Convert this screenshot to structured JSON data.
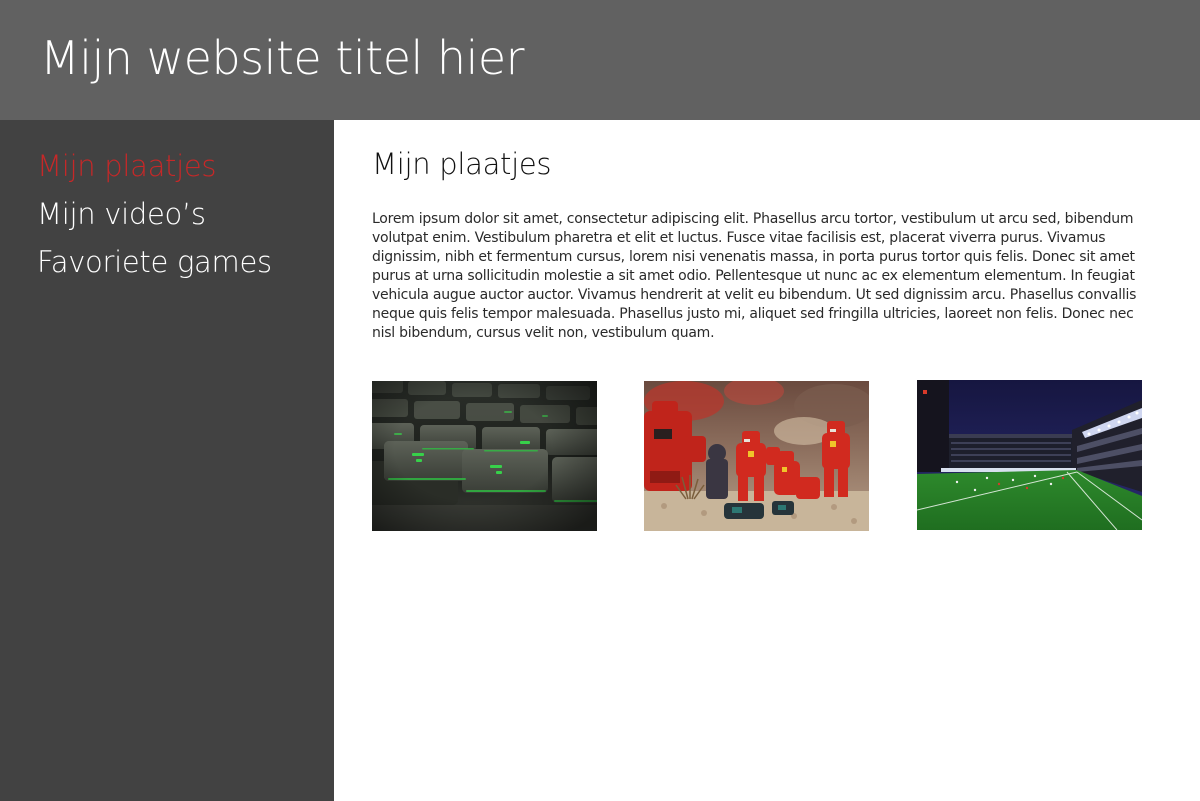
{
  "header": {
    "title": "Mijn website titel hier"
  },
  "sidebar": {
    "items": [
      {
        "label": "Mijn plaatjes",
        "active": true
      },
      {
        "label": "Mijn video’s",
        "active": false
      },
      {
        "label": "Favoriete games",
        "active": false
      }
    ]
  },
  "main": {
    "heading": "Mijn plaatjes",
    "paragraph": "Lorem ipsum dolor sit amet, consectetur adipiscing elit. Phasellus arcu tortor, vestibulum ut arcu sed, bibendum volutpat enim. Vestibulum pharetra et elit et luctus. Fusce vitae facilisis est, placerat viverra purus. Vivamus dignissim, nibh et fermentum cursus, lorem nisi venenatis massa, in porta purus tortor quis felis. Donec sit amet purus at urna sollicitudin molestie a sit amet odio. Pellentesque ut nunc ac ex elementum elementum. In feugiat vehicula augue auctor auctor. Vivamus hendrerit at velit eu bibendum. Ut sed dignissim arcu. Phasellus convallis neque quis felis tempor malesuada. Phasellus justo mi, aliquet sed fringilla ultricies, laoreet non felis. Donec nec nisl bibendum, cursus velit non, vestibulum quam.",
    "images": [
      {
        "subject": "keyboard-photo"
      },
      {
        "subject": "lego-robots-photo"
      },
      {
        "subject": "football-stadium-photo"
      }
    ]
  },
  "colors": {
    "header_bg": "#616161",
    "sidebar_bg": "#424242",
    "active_nav": "#c62828",
    "nav_text": "#ffffff",
    "content_bg": "#ffffff"
  }
}
